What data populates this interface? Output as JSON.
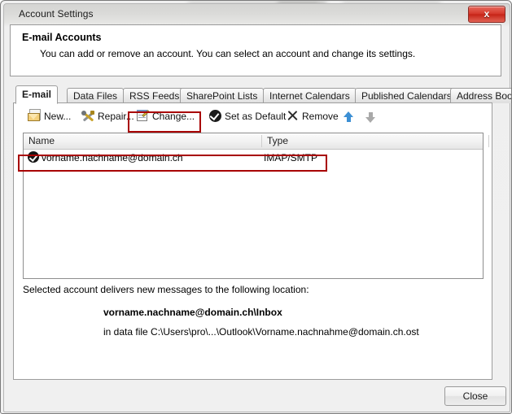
{
  "window": {
    "title": "Account Settings",
    "close_glyph": "x",
    "close_icon_name": "window-close-icon"
  },
  "header": {
    "title": "E-mail Accounts",
    "subtitle": "You can add or remove an account. You can select an account and change its settings."
  },
  "tabs": [
    {
      "label": "E-mail",
      "active": true
    },
    {
      "label": "Data Files",
      "active": false
    },
    {
      "label": "RSS Feeds",
      "active": false
    },
    {
      "label": "SharePoint Lists",
      "active": false
    },
    {
      "label": "Internet Calendars",
      "active": false
    },
    {
      "label": "Published Calendars",
      "active": false
    },
    {
      "label": "Address Books",
      "active": false
    }
  ],
  "toolbar": {
    "new_label": "New...",
    "repair_label": "Repair...",
    "change_label": "Change...",
    "set_default_label": "Set as Default",
    "remove_label": "Remove",
    "move_up_icon": "arrow-up-icon",
    "move_down_icon": "arrow-down-icon"
  },
  "list": {
    "columns": [
      "Name",
      "Type"
    ],
    "rows": [
      {
        "name": "vorname.nachname@domain.ch",
        "type": "IMAP/SMTP",
        "selected": true,
        "default_icon": "check-circle-icon"
      }
    ]
  },
  "info": {
    "line1": "Selected account delivers new messages to the following location:",
    "location": "vorname.nachname@domain.ch\\Inbox",
    "datafile": "in data file C:\\Users\\pro\\...\\Outlook\\Vorname.nachnahme@domain.ch.ost"
  },
  "footer": {
    "close_label": "Close"
  },
  "annotations": {
    "highlight_color": "#a80000",
    "boxes": [
      "change-button",
      "account-row"
    ]
  }
}
